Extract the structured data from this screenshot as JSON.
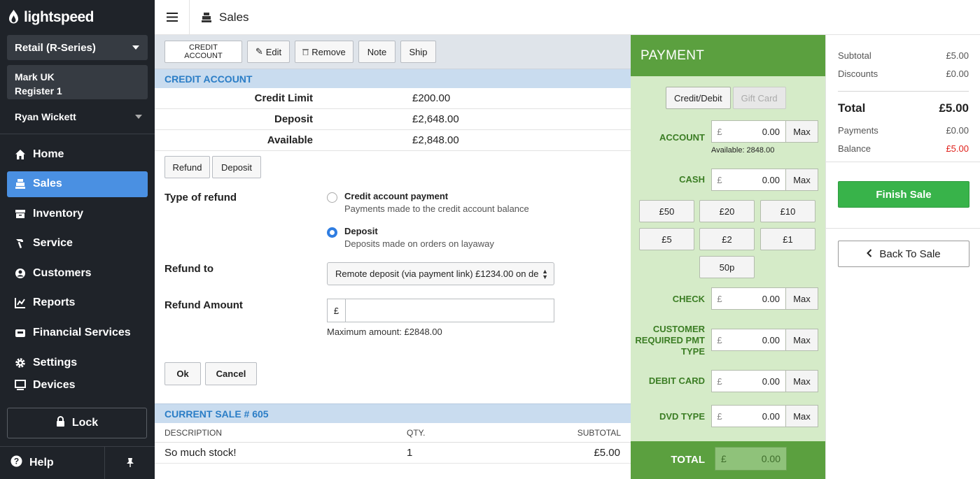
{
  "brand": {
    "name": "lightspeed"
  },
  "sidebar": {
    "store": "Retail (R-Series)",
    "register_line1": "Mark UK",
    "register_line2": "Register 1",
    "user": "Ryan Wickett",
    "items": [
      {
        "label": "Home",
        "icon": "home-icon"
      },
      {
        "label": "Sales",
        "icon": "register-icon"
      },
      {
        "label": "Inventory",
        "icon": "inventory-icon"
      },
      {
        "label": "Service",
        "icon": "hammer-icon"
      },
      {
        "label": "Customers",
        "icon": "user-circle-icon"
      },
      {
        "label": "Reports",
        "icon": "chart-icon"
      },
      {
        "label": "Financial Services",
        "icon": "bank-icon"
      },
      {
        "label": "Settings",
        "icon": "gear-icon"
      },
      {
        "label": "Devices",
        "icon": "monitor-icon"
      }
    ],
    "lock": "Lock",
    "help": "Help"
  },
  "topbar": {
    "title": "Sales"
  },
  "toolbar": {
    "credit_account": "CREDIT ACCOUNT",
    "edit": "Edit",
    "remove": "Remove",
    "note": "Note",
    "ship": "Ship"
  },
  "credit": {
    "header": "CREDIT ACCOUNT",
    "rows": [
      {
        "label": "Credit Limit",
        "value": "£200.00"
      },
      {
        "label": "Deposit",
        "value": "£2,648.00"
      },
      {
        "label": "Available",
        "value": "£2,848.00"
      }
    ],
    "tab_refund": "Refund",
    "tab_deposit": "Deposit"
  },
  "refund_form": {
    "type_label": "Type of refund",
    "option1_title": "Credit account payment",
    "option1_sub": "Payments made to the credit account balance",
    "option2_title": "Deposit",
    "option2_sub": "Deposits made on orders on layaway",
    "refund_to_label": "Refund to",
    "refund_to_value": "Remote deposit (via payment link) £1234.00 on de",
    "amount_label": "Refund Amount",
    "currency": "£",
    "amount_value": "",
    "max_note": "Maximum amount: £2848.00",
    "ok": "Ok",
    "cancel": "Cancel"
  },
  "current_sale": {
    "header": "CURRENT SALE # 605",
    "columns": [
      "DESCRIPTION",
      "QTY.",
      "SUBTOTAL"
    ],
    "rows": [
      {
        "description": "So much stock!",
        "qty": "1",
        "subtotal": "£5.00"
      }
    ]
  },
  "payment": {
    "header": "PAYMENT",
    "tab_credit": "Credit/Debit",
    "tab_gift": "Gift Card",
    "currency": "£",
    "max": "Max",
    "account_label": "ACCOUNT",
    "account_value": "0.00",
    "available_note": "Available: 2848.00",
    "cash_label": "CASH",
    "cash_value": "0.00",
    "denominations": [
      "£50",
      "£20",
      "£10",
      "£5",
      "£2",
      "£1",
      "50p"
    ],
    "check_label": "CHECK",
    "check_value": "0.00",
    "crpt_label_1": "CUSTOMER",
    "crpt_label_2": "REQUIRED PMT",
    "crpt_label_3": "TYPE",
    "crpt_value": "0.00",
    "debit_label": "DEBIT CARD",
    "debit_value": "0.00",
    "dvd_label": "DVD TYPE",
    "dvd_value": "0.00",
    "total_label": "TOTAL",
    "total_value": "0.00"
  },
  "summary": {
    "subtotal_label": "Subtotal",
    "subtotal": "£5.00",
    "discounts_label": "Discounts",
    "discounts": "£0.00",
    "total_label": "Total",
    "total": "£5.00",
    "payments_label": "Payments",
    "payments": "£0.00",
    "balance_label": "Balance",
    "balance": "£5.00",
    "finish": "Finish Sale",
    "back": "Back To Sale"
  },
  "colors": {
    "accent": "#4a90e2",
    "payment_green": "#5ba03f",
    "finish_green": "#38b34a",
    "balance_red": "#e0221c"
  }
}
